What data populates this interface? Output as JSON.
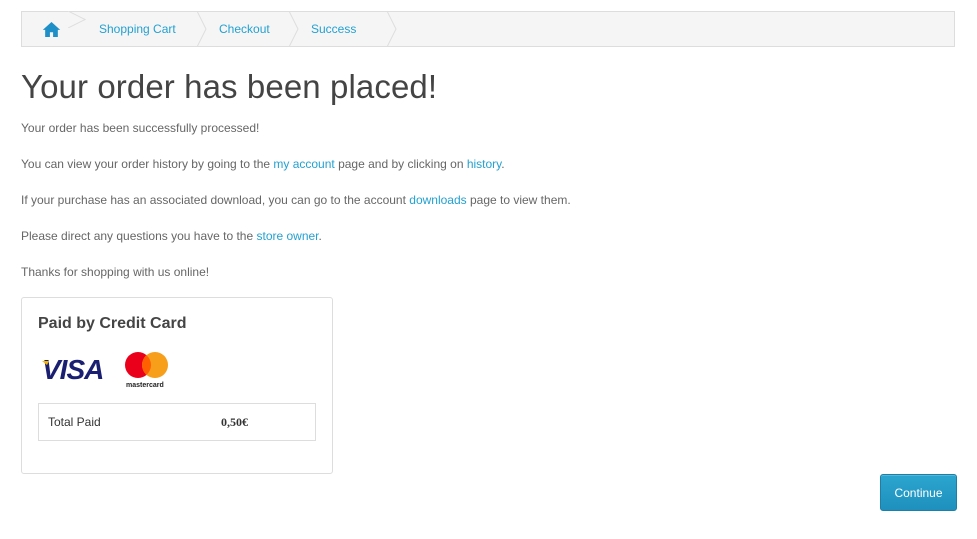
{
  "breadcrumb": {
    "home_icon": "home-icon",
    "items": [
      "Shopping Cart",
      "Checkout",
      "Success"
    ]
  },
  "heading": "Your order has been placed!",
  "messages": {
    "processed": "Your order has been successfully processed!",
    "history_prefix": "You can view your order history by going to the ",
    "history_link_account": "my account",
    "history_middle": " page and by clicking on ",
    "history_link_history": "history",
    "history_suffix": ".",
    "download_prefix": "If your purchase has an associated download, you can go to the account ",
    "download_link": "downloads",
    "download_suffix": " page to view them.",
    "questions_prefix": "Please direct any questions you have to the ",
    "questions_link": "store owner",
    "questions_suffix": ".",
    "thanks": "Thanks for shopping with us online!"
  },
  "payment": {
    "title": "Paid by Credit Card",
    "logos": {
      "visa": "VISA",
      "mastercard": "mastercard"
    },
    "total_label": "Total Paid",
    "total_value": "0,50€"
  },
  "continue_label": "Continue",
  "colors": {
    "link": "#23a1d1",
    "button": "#229ac8",
    "visa_blue": "#1a1f71",
    "mc_red": "#eb001b",
    "mc_orange": "#f79e1b"
  }
}
